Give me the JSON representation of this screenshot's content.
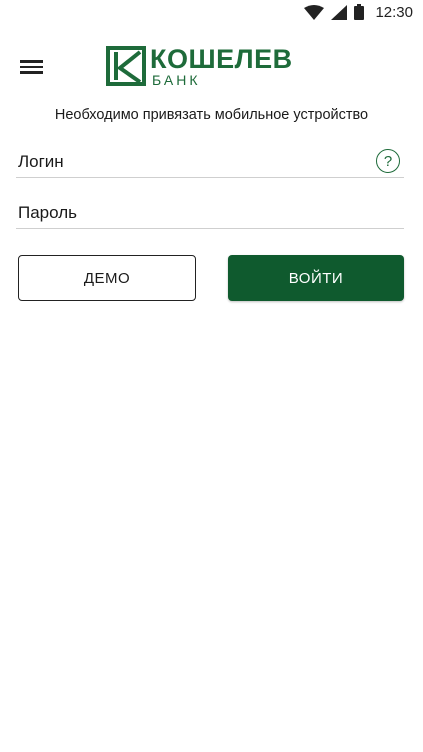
{
  "status_bar": {
    "time": "12:30",
    "icons": [
      "wifi-icon",
      "cell-signal-icon",
      "battery-icon"
    ]
  },
  "header": {
    "menu_icon": "hamburger-menu-icon",
    "logo": {
      "name": "КОШЕЛЕВ",
      "subtitle": "БАНК"
    }
  },
  "notice": "Необходимо привязать мобильное устройство",
  "form": {
    "login": {
      "placeholder": "Логин",
      "value": ""
    },
    "password": {
      "placeholder": "Пароль",
      "value": ""
    },
    "help_label": "?"
  },
  "buttons": {
    "demo": "ДЕМО",
    "login": "ВОЙТИ"
  },
  "colors": {
    "brand_green": "#1e6b3a",
    "button_green": "#0f5a2e",
    "divider": "#cfcfcf"
  }
}
